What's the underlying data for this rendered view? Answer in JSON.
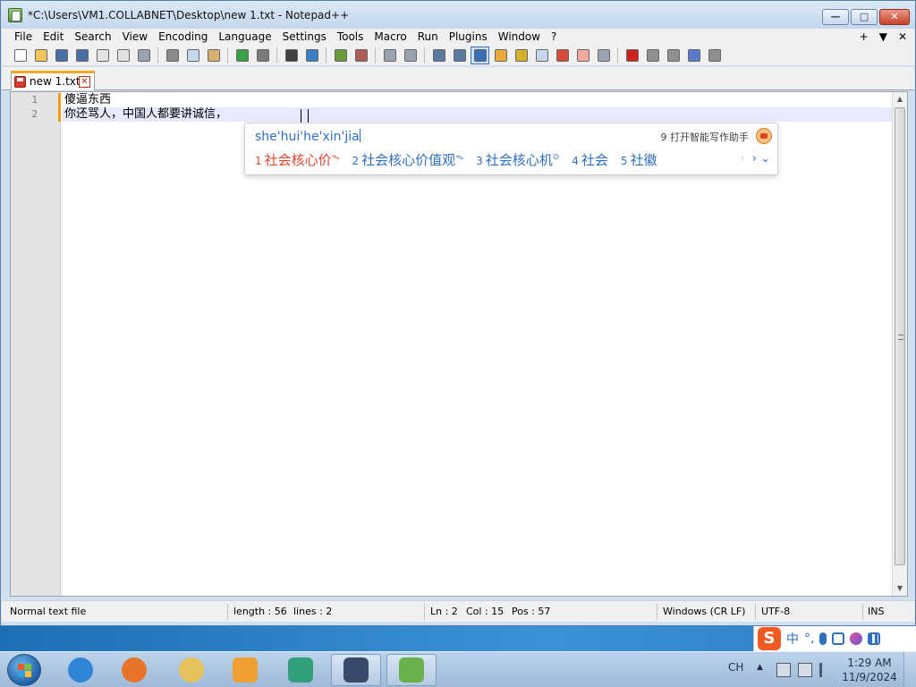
{
  "window": {
    "title": "*C:\\Users\\VM1.COLLABNET\\Desktop\\new 1.txt - Notepad++",
    "minimize_glyph": "—",
    "maximize_glyph": "□",
    "close_glyph": "✕"
  },
  "menubar": {
    "items": [
      "File",
      "Edit",
      "Search",
      "View",
      "Encoding",
      "Language",
      "Settings",
      "Tools",
      "Macro",
      "Run",
      "Plugins",
      "Window",
      "?"
    ],
    "right": [
      "+",
      "▼",
      "✕"
    ]
  },
  "toolbar": {
    "buttons": [
      {
        "name": "new-file-icon",
        "color": "#ffffff"
      },
      {
        "name": "open-file-icon",
        "color": "#f3c75a"
      },
      {
        "name": "save-icon",
        "color": "#4a6fa8"
      },
      {
        "name": "save-all-icon",
        "color": "#4a6fa8"
      },
      {
        "name": "close-file-icon",
        "color": "#e3e3e3"
      },
      {
        "name": "close-all-icon",
        "color": "#e3e3e3"
      },
      {
        "name": "print-icon",
        "color": "#9aa4b0"
      },
      {
        "sep": true
      },
      {
        "name": "cut-icon",
        "color": "#8a8a8a"
      },
      {
        "name": "copy-icon",
        "color": "#c8d8ec"
      },
      {
        "name": "paste-icon",
        "color": "#d8b070"
      },
      {
        "sep": true
      },
      {
        "name": "undo-icon",
        "color": "#3aa04a"
      },
      {
        "name": "redo-icon",
        "color": "#7a7a7a"
      },
      {
        "sep": true
      },
      {
        "name": "find-icon",
        "color": "#404040"
      },
      {
        "name": "replace-icon",
        "color": "#3a80c8"
      },
      {
        "sep": true
      },
      {
        "name": "zoom-in-icon",
        "color": "#6a9a3a"
      },
      {
        "name": "zoom-out-icon",
        "color": "#b05a5a"
      },
      {
        "sep": true
      },
      {
        "name": "sync-vertical-icon",
        "color": "#9aa4b0"
      },
      {
        "name": "sync-horizontal-icon",
        "color": "#9aa4b0"
      },
      {
        "sep": true
      },
      {
        "name": "word-wrap-icon",
        "color": "#5a7aa0"
      },
      {
        "name": "show-all-chars-icon",
        "color": "#5a7aa0"
      },
      {
        "name": "indent-guide-icon",
        "color": "#3a6fb6",
        "active": true
      },
      {
        "name": "udl-icon",
        "color": "#e8a83a"
      },
      {
        "name": "doc-map-icon",
        "color": "#d8b030"
      },
      {
        "name": "function-list-icon",
        "color": "#c8d8ec"
      },
      {
        "name": "folder-workspace-icon",
        "color": "#d84a3a"
      },
      {
        "name": "doc-list-icon",
        "color": "#f3a9a0"
      },
      {
        "name": "monitoring-icon",
        "color": "#9aa4b0"
      },
      {
        "sep": true
      },
      {
        "name": "record-macro-icon",
        "color": "#d02020"
      },
      {
        "name": "stop-record-icon",
        "color": "#909090"
      },
      {
        "name": "play-macro-icon",
        "color": "#909090"
      },
      {
        "name": "play-multiple-icon",
        "color": "#5a7ad0"
      },
      {
        "name": "save-macro-icon",
        "color": "#909090"
      }
    ]
  },
  "tab": {
    "label": "new 1.txt",
    "close_glyph": "✕"
  },
  "editor": {
    "line_numbers": [
      "1",
      "2"
    ],
    "lines": [
      "傻逼东西",
      "你还骂人，中国人都要讲诚信，"
    ]
  },
  "ime": {
    "pinyin": "she'hui'he'xin'jia",
    "assistant": "9 打开智能写作助手",
    "candidates": [
      {
        "num": "1",
        "text": "社会核心价",
        "badge": "ᯓ",
        "selected": true
      },
      {
        "num": "2",
        "text": "社会核心价值观",
        "badge": "ᯓ",
        "selected": false
      },
      {
        "num": "3",
        "text": "社会核心机",
        "badge": "⊙",
        "selected": false
      },
      {
        "num": "4",
        "text": "社会",
        "badge": "",
        "selected": false
      },
      {
        "num": "5",
        "text": "社徽",
        "badge": "",
        "selected": false
      }
    ],
    "nav_prev": "‹",
    "nav_next": "›",
    "nav_more": "⌄",
    "selected_color": "#e0442a",
    "text_color": "#2f6fbf"
  },
  "statusbar": {
    "file_type": "Normal text file",
    "length": "length : 56",
    "lines": "lines : 2",
    "ln": "Ln : 2",
    "col": "Col : 15",
    "pos": "Pos : 57",
    "eol": "Windows (CR LF)",
    "encoding": "UTF-8",
    "mode": "INS"
  },
  "ime_tray": {
    "logo": "S",
    "lang": "中",
    "punct": "°,",
    "icons": [
      "microphone-icon",
      "keyboard-icon",
      "skin-icon",
      "toolbox-icon"
    ]
  },
  "taskbar": {
    "apps": [
      {
        "name": "ie-app-icon",
        "color": "#2f86d8"
      },
      {
        "name": "firefox-app-icon",
        "color": "#e8742a"
      },
      {
        "name": "explorer-app-icon",
        "color": "#e6c25a"
      },
      {
        "name": "media-player-app-icon",
        "color": "#f0a030"
      },
      {
        "name": "chat-app-icon",
        "color": "#2fa07a"
      },
      {
        "name": "robot-app-icon",
        "color": "#3a4a6a",
        "open": true
      },
      {
        "name": "notepadpp-app-icon",
        "color": "#6ab04a",
        "open": true
      }
    ],
    "lang": "CH",
    "tray_arrow": "▲",
    "time": "1:29 AM",
    "date": "11/9/2024"
  }
}
